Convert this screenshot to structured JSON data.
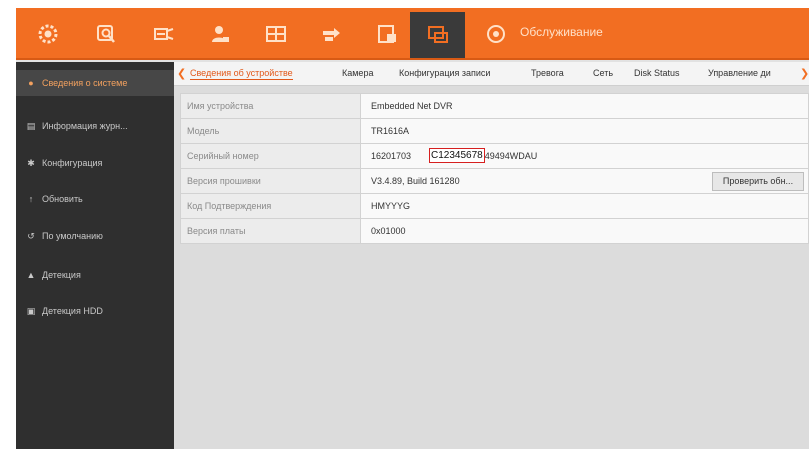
{
  "toolbar": {
    "colors": {
      "bar": "#f26e22",
      "active": "#3a3a3a"
    },
    "icons": [
      "gear-icon",
      "search-icon",
      "camera-link-icon",
      "user-icon",
      "grid-icon",
      "network-icon",
      "export-icon",
      "monitor-icon",
      "circle-icon"
    ],
    "label": "Обслуживание"
  },
  "sidebar": {
    "items": [
      {
        "icon": "info-icon",
        "label": "Сведения о системе"
      },
      {
        "icon": "file-icon",
        "label": "Информация журн..."
      },
      {
        "icon": "gear-icon",
        "label": "Конфигурация"
      },
      {
        "icon": "refresh-icon",
        "label": "Обновить"
      },
      {
        "icon": "reset-icon",
        "label": "По умолчанию"
      },
      {
        "icon": "warning-icon",
        "label": "Детекция"
      },
      {
        "icon": "disk-icon",
        "label": "Детекция HDD"
      }
    ]
  },
  "tabs": {
    "items": [
      "Сведения об устройстве",
      "Камера",
      "Конфигурация записи",
      "Тревога",
      "Сеть",
      "Disk Status",
      "Управление ди"
    ]
  },
  "info": {
    "rows": [
      {
        "key": "Имя устройства",
        "value": "Embedded Net DVR"
      },
      {
        "key": "Модель",
        "value": "TR1616A"
      },
      {
        "key": "Серийный номер",
        "value_prefix": "16201703",
        "value_masked": "C12345678",
        "value_suffix": "49494WDAU"
      },
      {
        "key": "Версия прошивки",
        "value": "V3.4.89, Build 161280"
      },
      {
        "key": "Код Подтверждения",
        "value": "HMYYYG"
      },
      {
        "key": "Версия платы",
        "value": "0x01000"
      }
    ],
    "check_button": "Проверить обн..."
  }
}
